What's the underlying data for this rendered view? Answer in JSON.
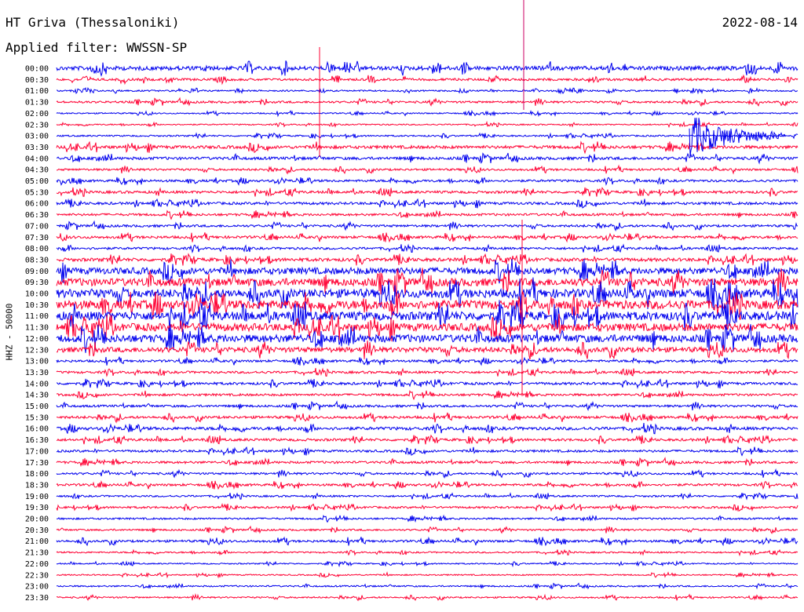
{
  "header": {
    "title": "HT Griva (Thessaloniki)",
    "date": "2022-08-14",
    "filter": "Applied filter: WWSSN-SP"
  },
  "axis": {
    "ylabel": "HHZ - 50000"
  },
  "colors": {
    "even_trace": "#0000ee",
    "odd_trace": "#ff0033",
    "background": "#ffffff"
  },
  "chart_data": {
    "type": "line",
    "chart_subtype": "seismogram helicorder",
    "title": "HT Griva (Thessaloniki)",
    "ylabel": "HHZ - 50000",
    "rows": [
      "00:00",
      "00:30",
      "01:00",
      "01:30",
      "02:00",
      "02:30",
      "03:00",
      "03:30",
      "04:00",
      "04:30",
      "05:00",
      "05:30",
      "06:00",
      "06:30",
      "07:00",
      "07:30",
      "08:00",
      "08:30",
      "09:00",
      "09:30",
      "10:00",
      "10:30",
      "11:00",
      "11:30",
      "12:00",
      "12:30",
      "13:00",
      "13:30",
      "14:00",
      "14:30",
      "15:00",
      "15:30",
      "16:00",
      "16:30",
      "17:00",
      "17:30",
      "18:00",
      "18:30",
      "19:00",
      "19:30",
      "20:00",
      "20:30",
      "21:00",
      "21:30",
      "22:00",
      "22:30",
      "23:00",
      "23:30"
    ],
    "relative_activity": [
      1.6,
      0.9,
      0.6,
      0.8,
      0.5,
      0.5,
      0.6,
      1.2,
      1.1,
      0.8,
      0.9,
      1.0,
      1.0,
      0.9,
      0.9,
      1.0,
      0.9,
      1.3,
      2.6,
      3.0,
      3.4,
      3.4,
      3.4,
      3.0,
      3.0,
      2.0,
      0.9,
      0.9,
      1.0,
      0.9,
      0.9,
      1.0,
      1.2,
      1.0,
      0.9,
      0.9,
      0.8,
      0.9,
      0.7,
      0.8,
      0.7,
      0.7,
      0.9,
      0.6,
      0.5,
      0.5,
      0.6,
      0.6
    ],
    "grid": false,
    "legend": "none"
  }
}
